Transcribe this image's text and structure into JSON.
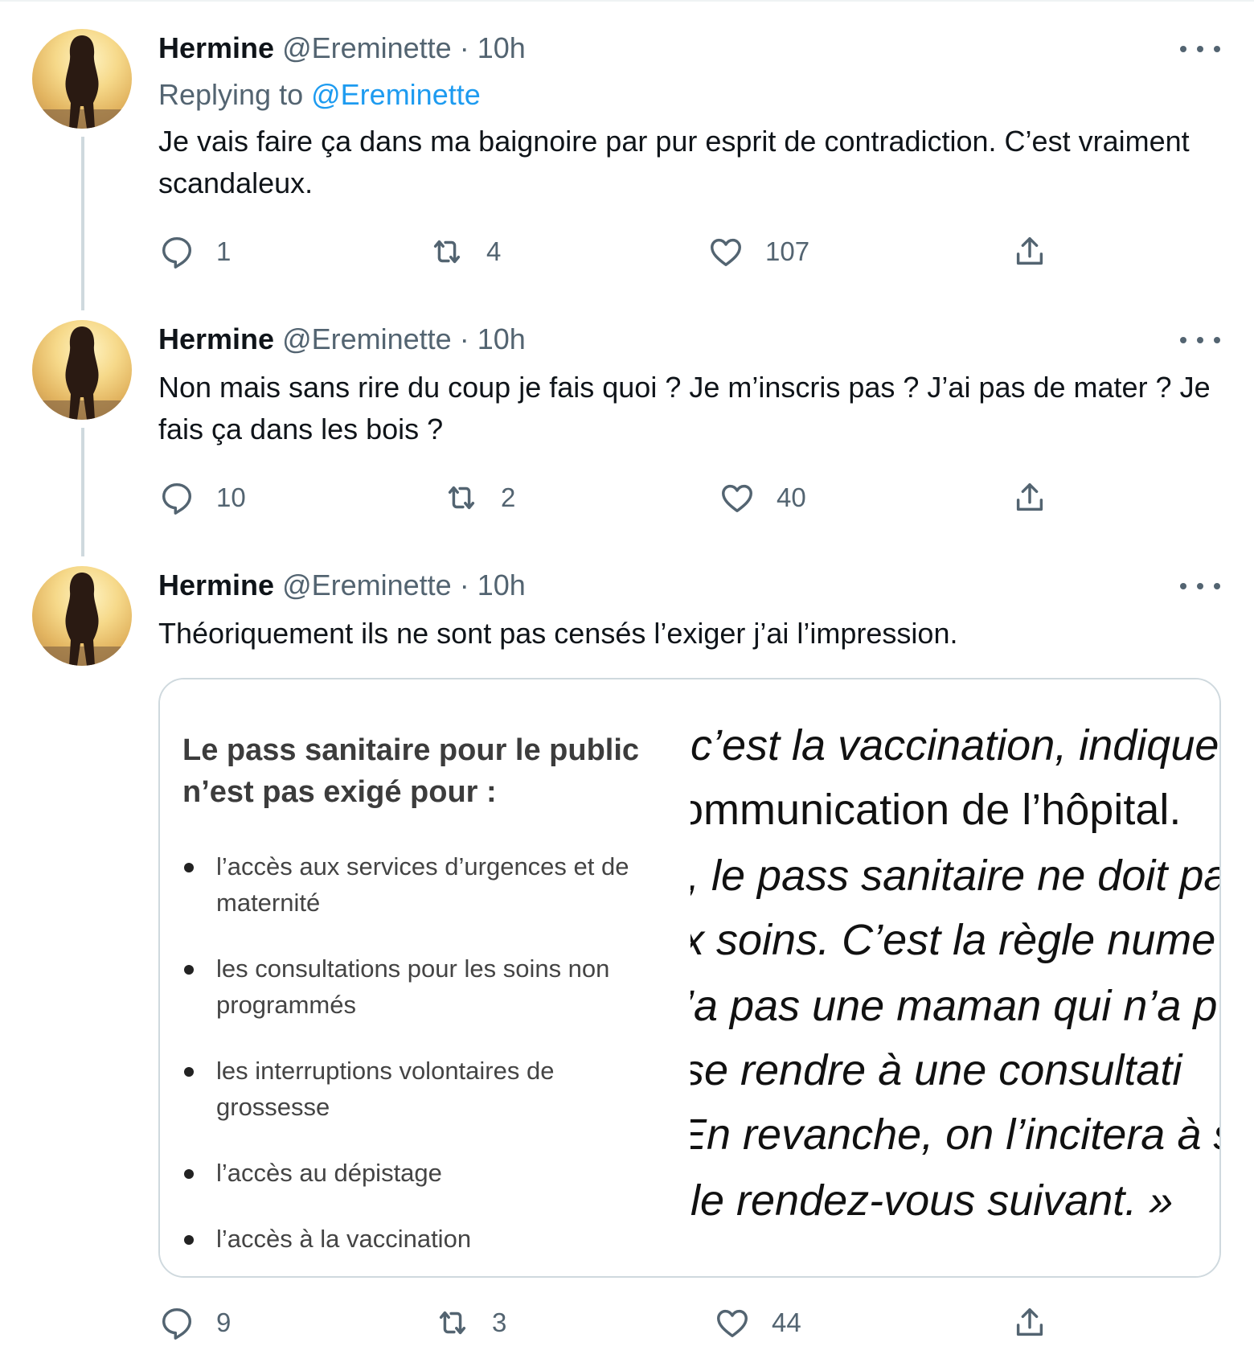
{
  "tweets": [
    {
      "name": "Hermine",
      "handle": "@Ereminette",
      "separator": "·",
      "time": "10h",
      "replying_label": "Replying to",
      "replying_to": "@Ereminette",
      "text": "Je vais faire ça dans ma baignoire par pur esprit de contradiction. C’est vraiment scandaleux.",
      "replies": "1",
      "retweets": "4",
      "likes": "107"
    },
    {
      "name": "Hermine",
      "handle": "@Ereminette",
      "separator": "·",
      "time": "10h",
      "text": "Non mais sans rire du coup je fais quoi ? Je m’inscris pas ? J’ai pas de mater ? Je fais ça dans les bois ?",
      "replies": "10",
      "retweets": "2",
      "likes": "40"
    },
    {
      "name": "Hermine",
      "handle": "@Ereminette",
      "separator": "·",
      "time": "10h",
      "text": "Théoriquement ils ne sont pas censés l’exiger j’ai l’impression.",
      "replies": "9",
      "retweets": "3",
      "likes": "44",
      "card": {
        "title": "Le pass sanitaire pour le public n’est pas exigé pour :",
        "bullets": [
          "l’accès aux services d’urgences et de maternité",
          "les consultations pour les soins non programmés",
          "les interruptions volontaires de grossesse",
          "l’accès au dépistage",
          "l’accès à la vaccination"
        ],
        "quote_lines": [
          "c’est la vaccination, indique",
          "ommunication de l’hôpital.",
          ", le pass sanitaire ne doit pa",
          "x soins. C’est la règle nume",
          "’a pas une maman qui n’a p",
          "se rendre à une consultati",
          "En revanche, on l’incitera à s",
          "le rendez-vous suivant. »"
        ]
      }
    }
  ],
  "icons": {
    "reply": "reply-icon",
    "retweet": "retweet-icon",
    "like": "heart-icon",
    "share": "share-icon",
    "more": "more-icon"
  },
  "colors": {
    "link": "#1d9bf0",
    "secondary_text": "#536471",
    "thread_line": "#cfd9de"
  }
}
